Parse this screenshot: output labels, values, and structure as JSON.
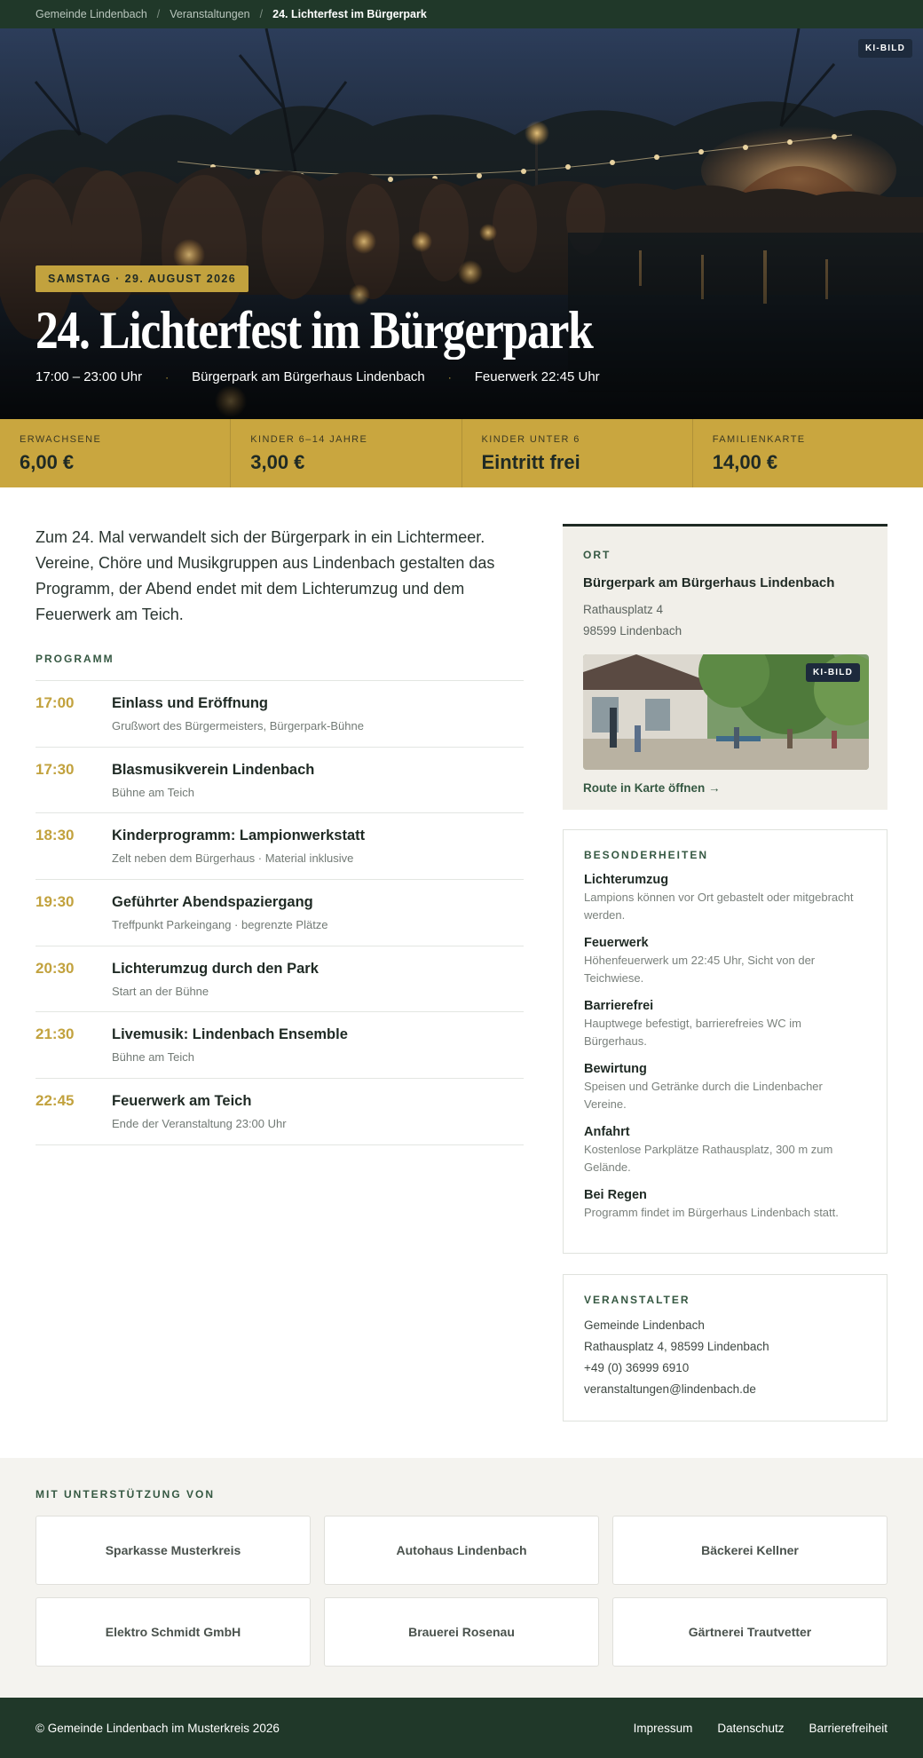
{
  "breadcrumb": {
    "items": [
      "Gemeinde Lindenbach",
      "Veranstaltungen"
    ],
    "separator": "/",
    "current": "24. Lichterfest im Bürgerpark"
  },
  "hero": {
    "ki_badge": "KI-BILD",
    "date_badge": "SAMSTAG · 29. AUGUST 2026",
    "title": "24. Lichterfest im Bürgerpark",
    "time": "17:00 – 23:00 Uhr",
    "location": "Bürgerpark am Bürgerhaus Lindenbach",
    "fireworks": "Feuerwerk 22:45 Uhr",
    "dot": "·"
  },
  "prices": [
    {
      "label": "ERWACHSENE",
      "value": "6,00 €"
    },
    {
      "label": "KINDER 6–14 JAHRE",
      "value": "3,00 €"
    },
    {
      "label": "KINDER UNTER 6",
      "value": "Eintritt frei"
    },
    {
      "label": "FAMILIENKARTE",
      "value": "14,00 €"
    }
  ],
  "intro": "Zum 24. Mal verwandelt sich der Bürgerpark in ein Lichtermeer. Vereine, Chöre und Musikgruppen aus Lindenbach gestalten das Programm, der Abend endet mit dem Lichterumzug und dem Feuerwerk am Teich.",
  "program": {
    "label": "PROGRAMM",
    "items": [
      {
        "time": "17:00",
        "title": "Einlass und Eröffnung",
        "sub": "Grußwort des Bürgermeisters, Bürgerpark-Bühne"
      },
      {
        "time": "17:30",
        "title": "Blasmusikverein Lindenbach",
        "sub": "Bühne am Teich"
      },
      {
        "time": "18:30",
        "title": "Kinderprogramm: Lampionwerkstatt",
        "sub": "Zelt neben dem Bürgerhaus · Material inklusive"
      },
      {
        "time": "19:30",
        "title": "Geführter Abendspaziergang",
        "sub": "Treffpunkt Parkeingang · begrenzte Plätze"
      },
      {
        "time": "20:30",
        "title": "Lichterumzug durch den Park",
        "sub": "Start an der Bühne"
      },
      {
        "time": "21:30",
        "title": "Livemusik: Lindenbach Ensemble",
        "sub": "Bühne am Teich"
      },
      {
        "time": "22:45",
        "title": "Feuerwerk am Teich",
        "sub": "Ende der Veranstaltung 23:00 Uhr"
      }
    ]
  },
  "ort": {
    "label": "ORT",
    "name": "Bürgerpark am Bürgerhaus Lindenbach",
    "street": "Rathausplatz 4",
    "city": "98599 Lindenbach",
    "ki_badge": "KI-BILD",
    "route": "Route in Karte öffnen →"
  },
  "features": {
    "label": "BESONDERHEITEN",
    "items": [
      {
        "title": "Lichterumzug",
        "desc": "Lampions können vor Ort gebastelt oder mitgebracht werden."
      },
      {
        "title": "Feuerwerk",
        "desc": "Höhenfeuerwerk um 22:45 Uhr, Sicht von der Teichwiese."
      },
      {
        "title": "Barrierefrei",
        "desc": "Hauptwege befestigt, barrierefreies WC im Bürgerhaus."
      },
      {
        "title": "Bewirtung",
        "desc": "Speisen und Getränke durch die Lindenbacher Vereine."
      },
      {
        "title": "Anfahrt",
        "desc": "Kostenlose Parkplätze Rathausplatz, 300 m zum Gelände."
      },
      {
        "title": "Bei Regen",
        "desc": "Programm findet im Bürgerhaus Lindenbach statt."
      }
    ]
  },
  "organizer": {
    "label": "VERANSTALTER",
    "name": "Gemeinde Lindenbach",
    "address": "Rathausplatz 4, 98599 Lindenbach",
    "phone": "+49 (0) 36999 6910",
    "email": "veranstaltungen@lindenbach.de"
  },
  "sponsors": {
    "label": "MIT UNTERSTÜTZUNG VON",
    "items": [
      "Sparkasse Musterkreis",
      "Autohaus Lindenbach",
      "Bäckerei Kellner",
      "Elektro Schmidt GmbH",
      "Brauerei Rosenau",
      "Gärtnerei Trautvetter"
    ]
  },
  "footer": {
    "copyright": "© Gemeinde Lindenbach im Musterkreis 2026",
    "links": [
      "Impressum",
      "Datenschutz",
      "Barrierefreiheit"
    ]
  },
  "colors": {
    "dark_green": "#203829",
    "gold": "#c9a63f",
    "accent_text": "#c2a23e",
    "sidebar_bg": "#f1efe9",
    "sponsor_bg": "#f4f3ef"
  }
}
